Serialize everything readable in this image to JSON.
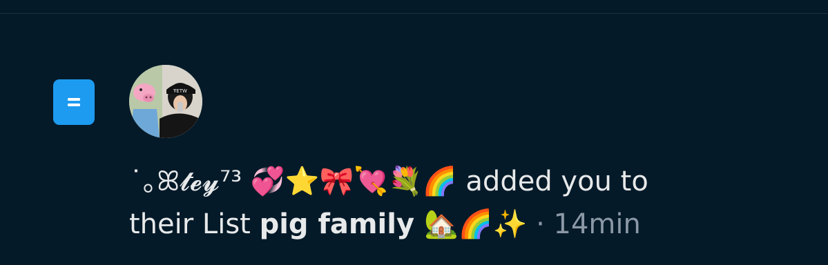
{
  "notification": {
    "type_icon": "list-icon",
    "avatar_icon": "user-avatar",
    "actor": {
      "display_name": "˙｡ꕤ𝓽𝓮𝔂⁷³ 💞⭐🎀💘💐🌈"
    },
    "action_text": " added you to",
    "line2_prefix": "their List ",
    "list_name": "pig family 🏡🌈✨",
    "separator": " · ",
    "timestamp": "14min"
  },
  "colors": {
    "background": "#051a29",
    "accent": "#1d9bf0",
    "primary_text": "#e7e9ea",
    "secondary_text": "#8b98a5"
  }
}
